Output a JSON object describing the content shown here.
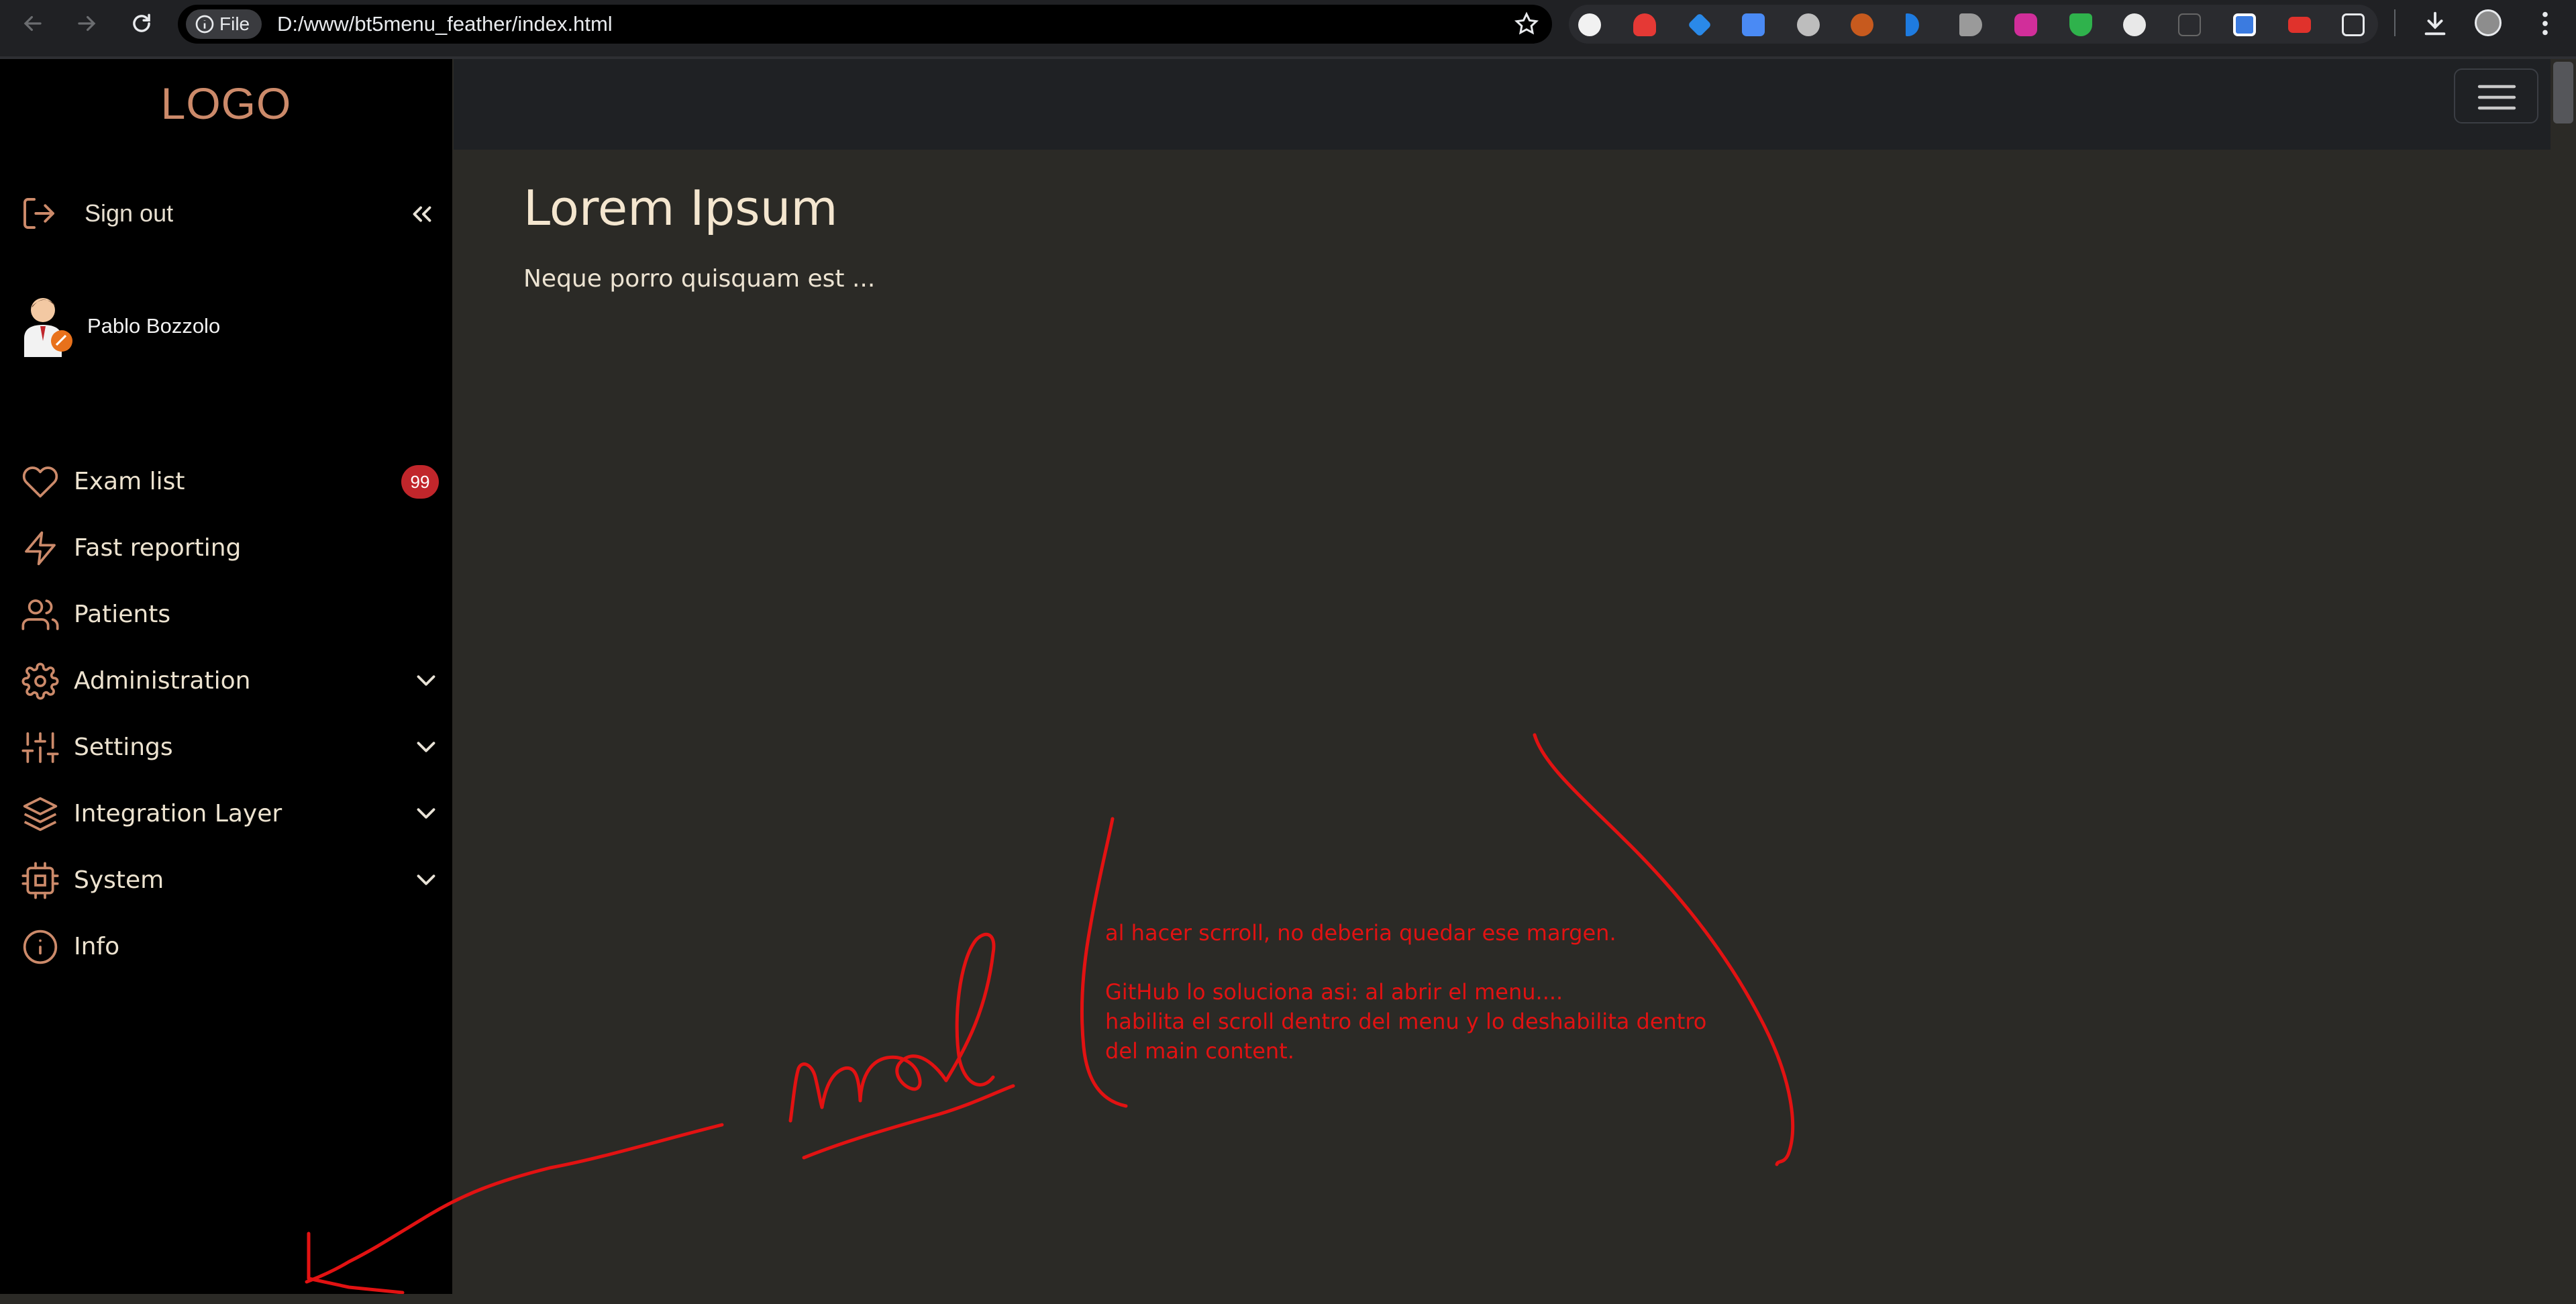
{
  "browser": {
    "file_chip_label": "File",
    "url": "D:/www/bt5menu_feather/index.html"
  },
  "sidebar": {
    "logo": "LOGO",
    "sign_out_label": "Sign out",
    "user_name": "Pablo Bozzolo",
    "items": [
      {
        "label": "Exam list",
        "icon": "heart-icon",
        "badge": "99"
      },
      {
        "label": "Fast reporting",
        "icon": "zap-icon"
      },
      {
        "label": "Patients",
        "icon": "users-icon"
      },
      {
        "label": "Administration",
        "icon": "settings-icon",
        "expandable": true
      },
      {
        "label": "Settings",
        "icon": "sliders-icon",
        "expandable": true
      },
      {
        "label": "Integration Layer",
        "icon": "layers-icon",
        "expandable": true
      },
      {
        "label": "System",
        "icon": "cpu-icon",
        "expandable": true
      },
      {
        "label": "Info",
        "icon": "info-icon"
      }
    ]
  },
  "main": {
    "title": "Lorem Ipsum",
    "subtitle": "Neque porro quisquam est ..."
  },
  "annotation": {
    "line1": "al hacer scrroll, no deberia quedar ese margen.",
    "line2": "GitHub lo soluciona asi: al abrir el menu....",
    "line3": "habilita el scroll dentro del menu y lo deshabilita dentro",
    "line4": "del main content.",
    "handwritten": "mal"
  },
  "colors": {
    "sidebar_bg": "#000000",
    "page_bg": "#2b2a26",
    "accent": "#cc8a6a",
    "badge": "#c1262b",
    "annotation": "#e21212"
  }
}
